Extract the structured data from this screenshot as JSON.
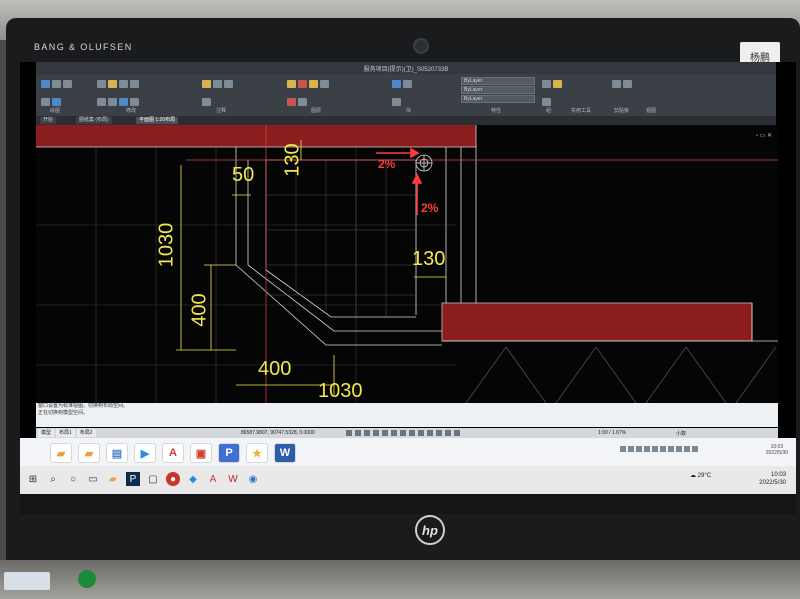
{
  "monitor": {
    "brand": "BANG & OLUFSEN",
    "logo": "hp",
    "sticker_label": "杨鹏"
  },
  "window": {
    "title": "服务项目(提示)(卫)_S0520733B"
  },
  "ribbon": {
    "groups": [
      "绘图",
      "修改",
      "注释",
      "图层",
      "块",
      "特性",
      "组",
      "实用工具",
      "剪贴板",
      "视图"
    ],
    "layer_dropdowns": [
      "ByLayer",
      "ByLayer",
      "ByLayer"
    ]
  },
  "doc_tabs": [
    "开始",
    "图纸集 (布局)",
    "平面图 1:20布局"
  ],
  "drawing": {
    "dims": [
      "50",
      "130",
      "130",
      "1030",
      "400",
      "400",
      "1030"
    ],
    "slopes": [
      "2%",
      "2%"
    ],
    "colors": {
      "dimension": "#f3e84a",
      "slope": "#ff3b3b",
      "hatch": "#8c1d1d",
      "grid": "#3a3a3a"
    }
  },
  "command_lines": [
    "窗口设置为标准视图。切换到布局空间。",
    "正在切换到模型空间。"
  ],
  "status": {
    "model_tabs": [
      "模型",
      "布局1",
      "布局2"
    ],
    "coords": "86587.9807, 90747.5328, 0.0000",
    "scale": "1:00 / 1.67%",
    "mode": "小数"
  },
  "windows_taskbar": {
    "weather": "29°C",
    "time": "10:03",
    "date": "2022/5/30",
    "apps": [
      "search-icon",
      "task-view-icon",
      "explorer-icon",
      "ps-icon",
      "autocad-icon",
      "red-app-icon",
      "pdf-icon",
      "browser-icon"
    ]
  },
  "row_apps": [
    "A",
    "A",
    "P",
    "W"
  ]
}
